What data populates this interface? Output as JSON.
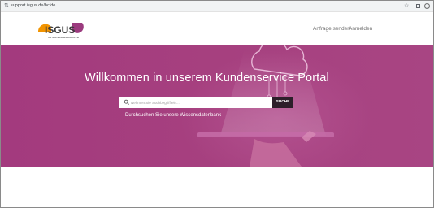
{
  "browser": {
    "url": "support.isgus.de/hc/de",
    "icons": {
      "site_info": "site-info-icon",
      "bookmark": "star-icon",
      "extensions": "extensions-icon",
      "profile": "profile-icon"
    }
  },
  "header": {
    "logo_text": "ISGUS",
    "logo_tagline": "UNTERNEHMENSGRUPPE",
    "nav": [
      {
        "label": "Anfrage senden"
      },
      {
        "label": "Anmelden"
      }
    ]
  },
  "hero": {
    "title": "Willkommen in unserem Kundenservice Portal",
    "search": {
      "placeholder": "Nehmen Sie Suchbegriff ein...",
      "button_label": "SUCHE",
      "icon": "search-icon"
    },
    "kb_link": "Durchsuchen Sie unsere Wissensdatenbank"
  },
  "colors": {
    "hero_background": "#a6407f",
    "search_button": "#2d1f2a",
    "logo_orange": "#f29400",
    "logo_purple": "#9b3b7e",
    "nav_text": "#6d6d6d"
  }
}
